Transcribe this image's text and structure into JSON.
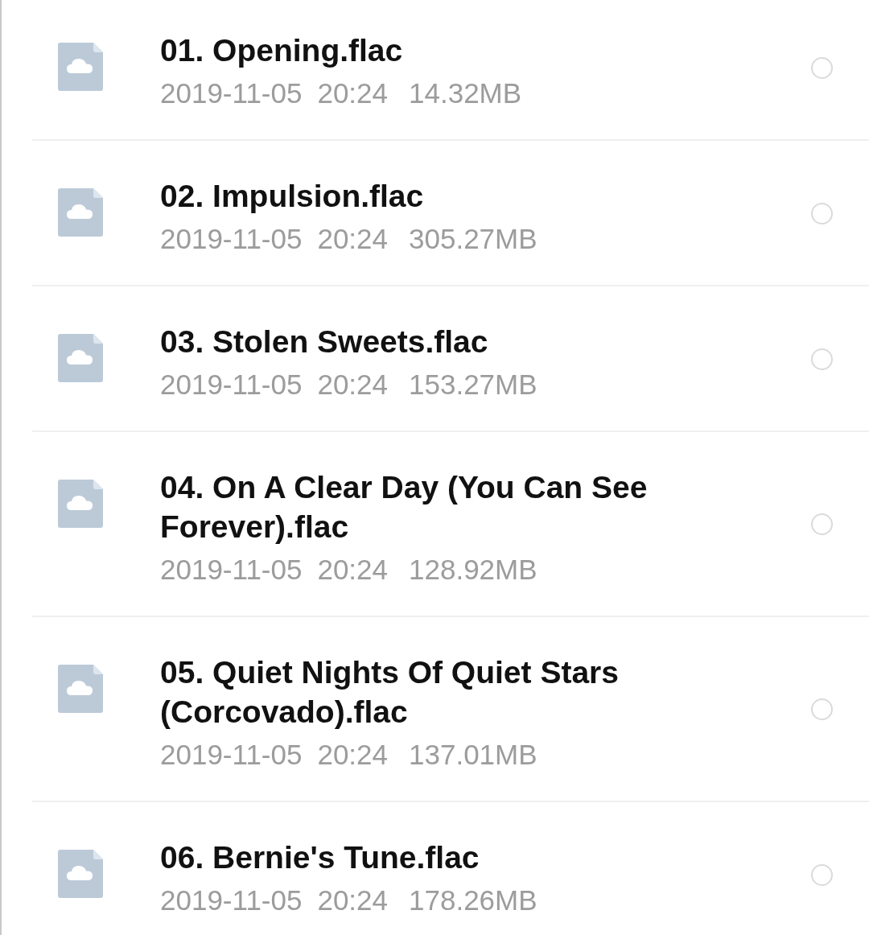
{
  "files": [
    {
      "name": "01. Opening.flac",
      "date": "2019-11-05",
      "time": "20:24",
      "size": "14.32MB",
      "selected": false
    },
    {
      "name": "02. Impulsion.flac",
      "date": "2019-11-05",
      "time": "20:24",
      "size": "305.27MB",
      "selected": false
    },
    {
      "name": "03. Stolen Sweets.flac",
      "date": "2019-11-05",
      "time": "20:24",
      "size": "153.27MB",
      "selected": false
    },
    {
      "name": "04. On A Clear Day (You Can See Forever).flac",
      "date": "2019-11-05",
      "time": "20:24",
      "size": "128.92MB",
      "selected": false
    },
    {
      "name": "05. Quiet Nights Of Quiet Stars (Corcovado).flac",
      "date": "2019-11-05",
      "time": "20:24",
      "size": "137.01MB",
      "selected": false
    },
    {
      "name": "06. Bernie's Tune.flac",
      "date": "2019-11-05",
      "time": "20:24",
      "size": "178.26MB",
      "selected": false
    }
  ]
}
